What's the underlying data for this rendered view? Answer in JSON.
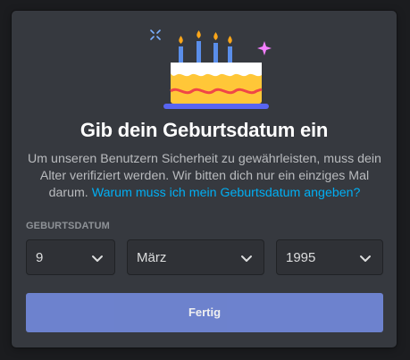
{
  "modal": {
    "title": "Gib dein Geburtsdatum ein",
    "description": "Um unseren Benutzern Sicherheit zu gewährleisten, muss dein Alter verifiziert werden. Wir bitten dich nur ein einziges Mal darum.",
    "link_text": "Warum muss ich mein Geburtsdatum angeben?",
    "field_label": "GEBURTSDATUM",
    "day": "9",
    "month": "März",
    "year": "1995",
    "submit_label": "Fertig"
  },
  "illustration": {
    "icon": "birthday-cake-icon",
    "colors": {
      "cake": "#ffc738",
      "frosting": "#ffffff",
      "stripe": "#f04747",
      "plate": "#5865f2",
      "candle": "#5a8eea",
      "flame": "#faa61a",
      "sparkle_pink": "#f47fff",
      "sparkle_green": "#43b581",
      "sparkle_blue": "#7ab0ff"
    }
  },
  "colors": {
    "background": "#36393f",
    "accent": "#7289da",
    "link": "#00aff4",
    "input_bg": "#2f3136"
  }
}
